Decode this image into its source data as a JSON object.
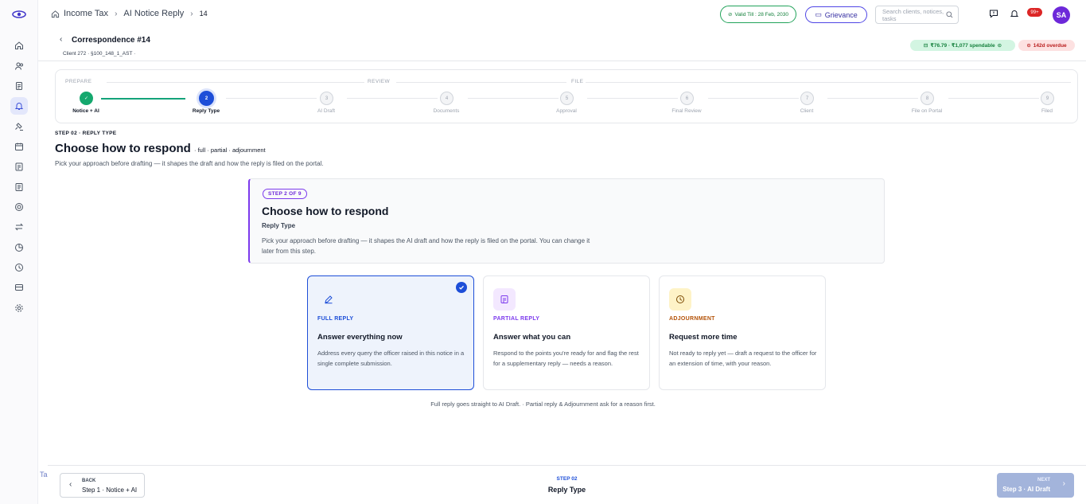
{
  "sidebar": {
    "icons": [
      "home-icon",
      "users-icon",
      "file-icon",
      "bell-icon",
      "gavel-icon",
      "calendar-icon",
      "clipboard-icon",
      "document-icon",
      "target-icon",
      "swap-icon",
      "pie-chart-icon",
      "clock-icon",
      "wallet-icon",
      "settings-icon"
    ],
    "active_index": 3,
    "bottom_text": "Ta"
  },
  "topbar": {
    "breadcrumb": [
      "Income Tax",
      "AI Notice Reply",
      "14"
    ],
    "valid_till": "Valid Till : 28 Feb, 2030",
    "grievance": "Grievance",
    "search_placeholder": "Search clients, notices, tasks",
    "notifications_badge": "99+",
    "avatar_initials": "SA"
  },
  "subheader": {
    "title": "Correspondence #14",
    "client": "Client 272 · §100_148_1_AST ·",
    "spendable": "₹76.79 · ₹1,077 spendable",
    "overdue": "142d overdue"
  },
  "stepper": {
    "phases": [
      "PREPARE",
      "REVIEW",
      "FILE"
    ],
    "steps": [
      {
        "num": "✓",
        "label": "Notice + AI",
        "state": "done"
      },
      {
        "num": "2",
        "label": "Reply Type",
        "state": "current"
      },
      {
        "num": "3",
        "label": "AI Draft",
        "state": "todo"
      },
      {
        "num": "4",
        "label": "Documents",
        "state": "todo"
      },
      {
        "num": "5",
        "label": "Approval",
        "state": "todo"
      },
      {
        "num": "6",
        "label": "Final Review",
        "state": "todo"
      },
      {
        "num": "7",
        "label": "Client",
        "state": "todo"
      },
      {
        "num": "8",
        "label": "File on Portal",
        "state": "todo"
      },
      {
        "num": "9",
        "label": "Filed",
        "state": "todo"
      }
    ]
  },
  "heading": {
    "eyebrow": "STEP 02 · REPLY TYPE",
    "title": "Choose how to respond",
    "tags": "· full · partial · adjournment",
    "lead": "Pick your approach before drafting — it shapes the draft and how the reply is filed on the portal."
  },
  "infobox": {
    "pill": "STEP 2 OF 9",
    "title": "Choose how to respond",
    "subtitle": "Reply Type",
    "body": "Pick your approach before drafting — it shapes the AI draft and how the reply is filed on the portal. You can change it later from this step."
  },
  "cards": [
    {
      "kicker": "FULL REPLY",
      "title": "Answer everything now",
      "desc": "Address every query the officer raised in this notice in a single complete submission.",
      "selected": true,
      "color": "#1d4ed8",
      "icon": "pencil-icon"
    },
    {
      "kicker": "PARTIAL REPLY",
      "title": "Answer what you can",
      "desc": "Respond to the points you're ready for and flag the rest for a supplementary reply — needs a reason.",
      "selected": false,
      "color": "#7c3aed",
      "icon": "document-icon"
    },
    {
      "kicker": "ADJOURNMENT",
      "title": "Request more time",
      "desc": "Not ready to reply yet — draft a request to the officer for an extension of time, with your reason.",
      "selected": false,
      "color": "#b45309",
      "icon": "clock-icon"
    }
  ],
  "footnote": "Full reply goes straight to AI Draft. · Partial reply & Adjournment ask for a reason first.",
  "footer": {
    "back_kicker": "BACK",
    "back_label": "Step 1 · Notice + AI",
    "step_kicker": "STEP 02",
    "step_name": "Reply Type",
    "next_kicker": "NEXT",
    "next_label": "Step 3 · AI Draft"
  },
  "colors": {
    "accent": "#1d4ed8",
    "done": "#15a86e",
    "purple": "#7c3aed",
    "amber": "#b45309"
  }
}
